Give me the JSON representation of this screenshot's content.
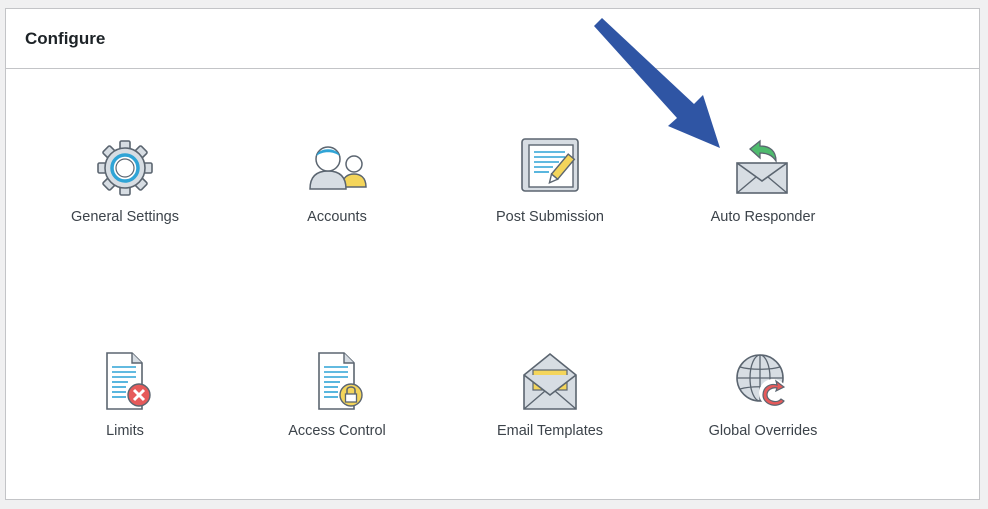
{
  "panel": {
    "title": "Configure"
  },
  "tiles": [
    {
      "label": "General Settings",
      "icon": "gear-icon"
    },
    {
      "label": "Accounts",
      "icon": "users-icon"
    },
    {
      "label": "Post Submission",
      "icon": "post-edit-icon"
    },
    {
      "label": "Auto Responder",
      "icon": "envelope-reply-icon"
    },
    {
      "label": "Limits",
      "icon": "document-block-icon"
    },
    {
      "label": "Access Control",
      "icon": "document-lock-icon"
    },
    {
      "label": "Email Templates",
      "icon": "open-envelope-icon"
    },
    {
      "label": "Global Overrides",
      "icon": "globe-refresh-icon"
    }
  ],
  "annotation": {
    "arrow_color": "#2f55a4",
    "target": "Auto Responder"
  }
}
